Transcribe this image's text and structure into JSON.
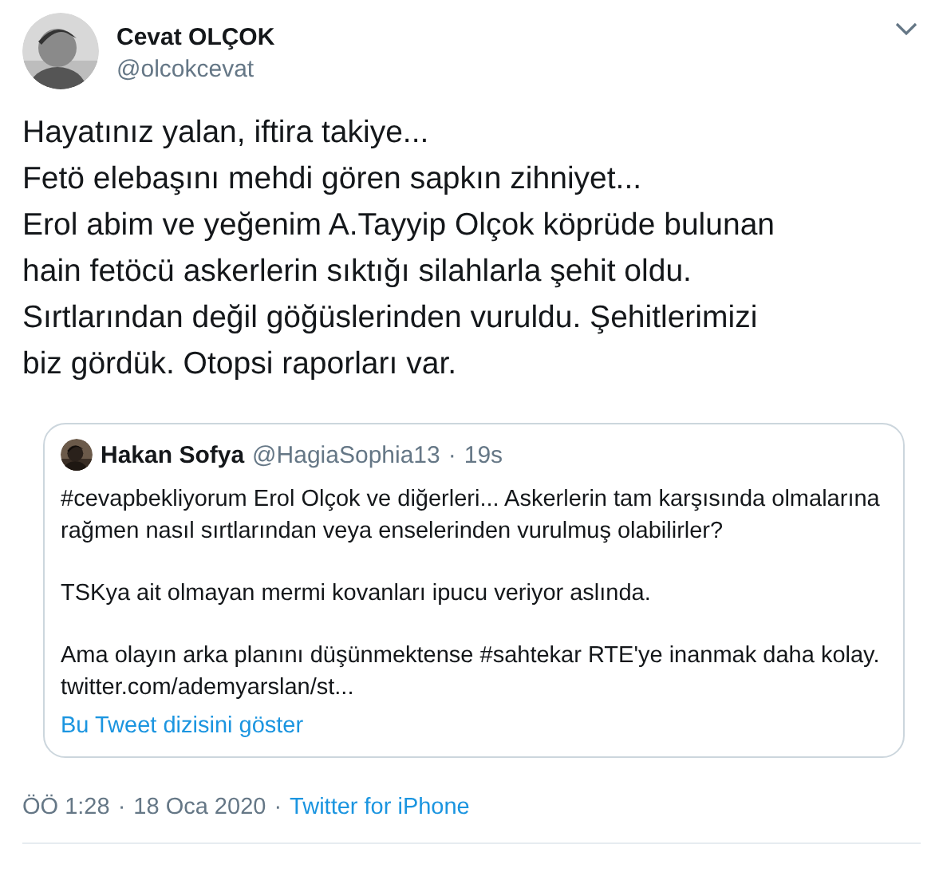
{
  "author": {
    "name": "Cevat OLÇOK",
    "handle": "@olcokcevat"
  },
  "menu": {
    "kind": "caret"
  },
  "body_lines": [
    "Hayatınız yalan, iftira takiye...",
    "Fetö elebaşını mehdi gören sapkın zihniyet...",
    "Erol abim ve yeğenim A.Tayyip Olçok köprüde bulunan",
    "hain fetöcü askerlerin sıktığı silahlarla şehit oldu.",
    "Sırtlarından değil göğüslerinden vuruldu. Şehitlerimizi",
    "biz gördük. Otopsi raporları var."
  ],
  "quote": {
    "name": "Hakan Sofya",
    "handle": "@HagiaSophia13",
    "separator": "·",
    "time": "19s",
    "paragraphs": [
      [
        "#cevapbekliyorum Erol Olçok ve diğerleri... Askerlerin tam karşısında olmalarına",
        "rağmen nasıl sırtlarından veya enselerinden vurulmuş olabilirler?"
      ],
      [
        "TSKya ait olmayan mermi kovanları ipucu veriyor aslında."
      ],
      [
        "Ama olayın arka planını düşünmektense #sahtekar RTE'ye inanmak daha kolay.",
        "twitter.com/ademyarslan/st..."
      ]
    ],
    "thread_link": "Bu Tweet dizisini göster"
  },
  "footer": {
    "time": "ÖÖ 1:28",
    "sep1": "·",
    "date": "18 Oca 2020",
    "sep2": "·",
    "source": "Twitter for iPhone"
  }
}
